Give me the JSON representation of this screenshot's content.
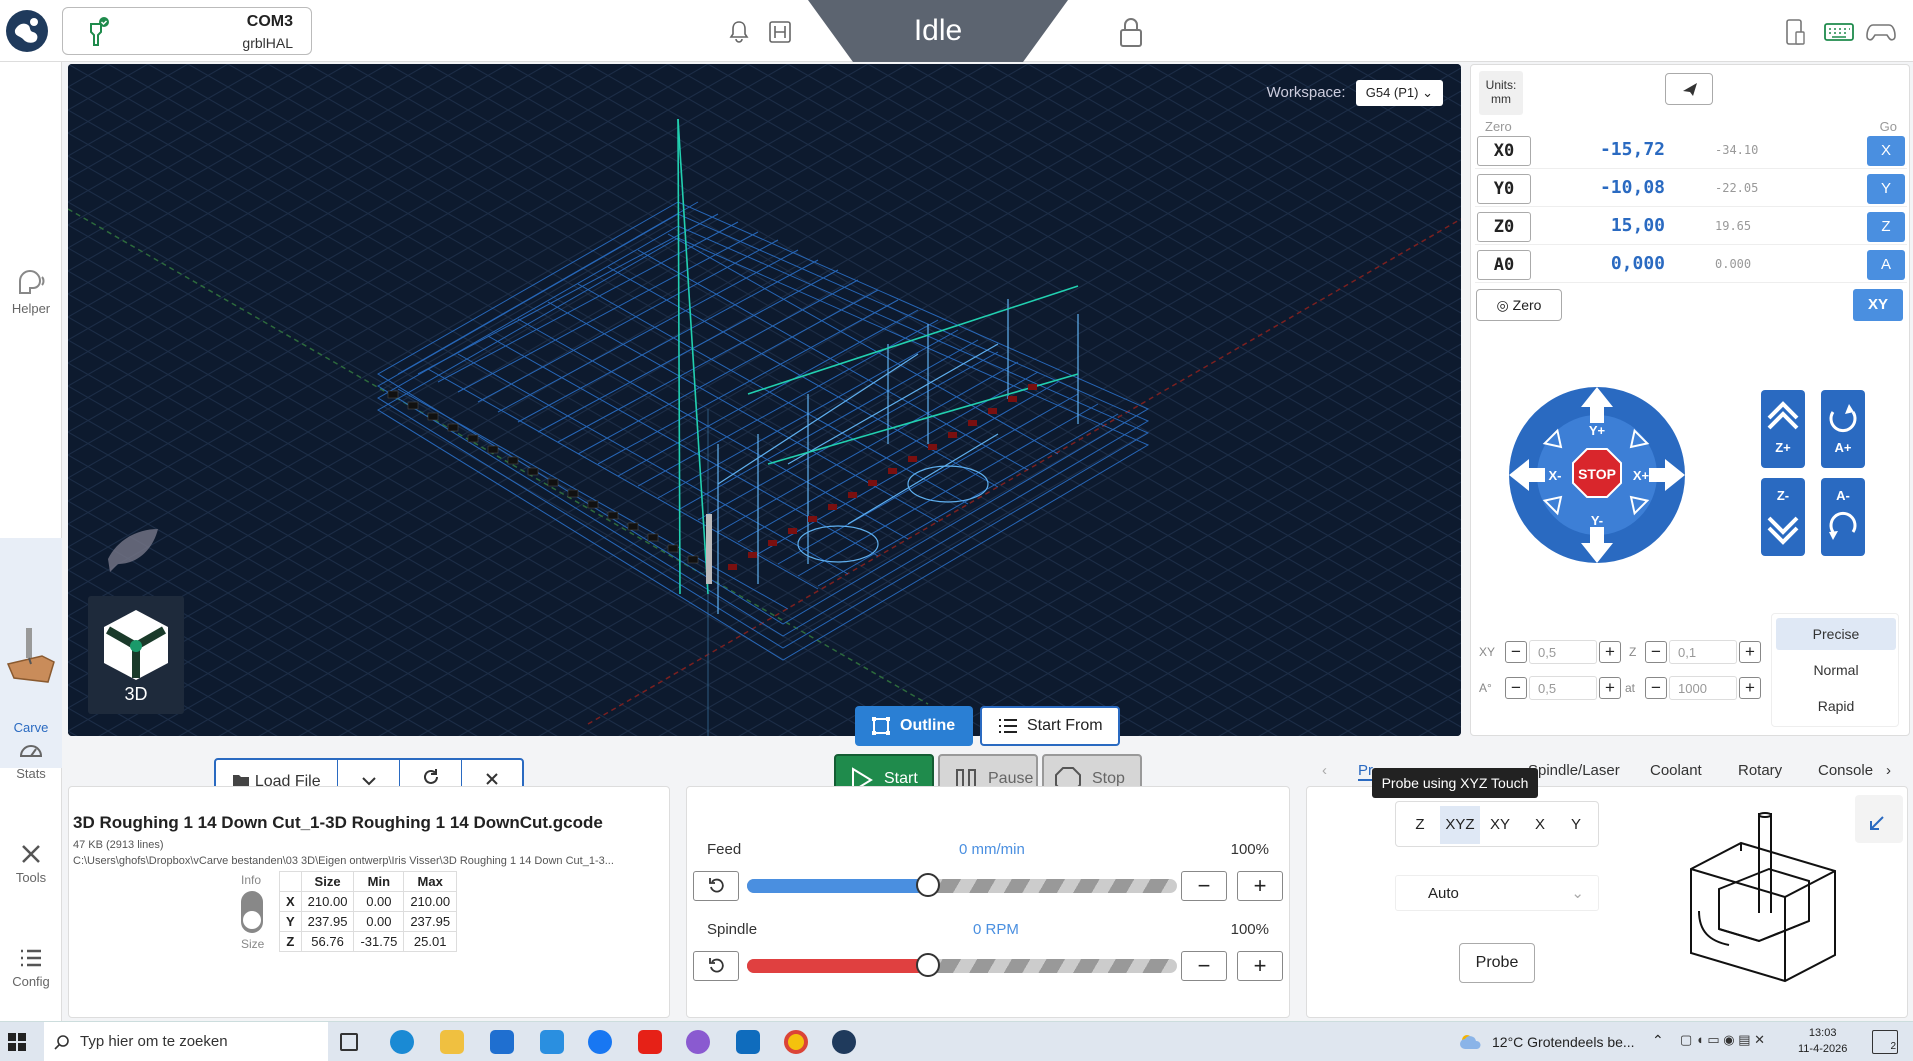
{
  "connection": {
    "port": "COM3",
    "firmware": "grblHAL"
  },
  "status": {
    "state": "Idle"
  },
  "nav": [
    {
      "label": "Helper"
    },
    {
      "label": "Carve"
    },
    {
      "label": "Stats"
    },
    {
      "label": "Tools"
    },
    {
      "label": "Config"
    }
  ],
  "viewport": {
    "workspace_label": "Workspace:",
    "workspace_value": "G54 (P1)",
    "view_label": "3D"
  },
  "dro": {
    "units_label": "Units:",
    "units_value": "mm",
    "zero_header": "Zero",
    "go_header": "Go",
    "axes": [
      {
        "name": "X0",
        "value": "-15,72",
        "mpos": "-34.10",
        "go": "X"
      },
      {
        "name": "Y0",
        "value": "-10,08",
        "mpos": "-22.05",
        "go": "Y"
      },
      {
        "name": "Z0",
        "value": "15,00",
        "mpos": "19.65",
        "go": "Z"
      },
      {
        "name": "A0",
        "value": "0,000",
        "mpos": "0.000",
        "go": "A"
      }
    ],
    "zero_button": "Zero",
    "xy_button": "XY"
  },
  "jog": {
    "y_plus": "Y+",
    "y_minus": "Y-",
    "x_plus": "X+",
    "x_minus": "X-",
    "stop": "STOP",
    "z_plus": "Z+",
    "z_minus": "Z-",
    "a_plus": "A+",
    "a_minus": "A-",
    "xy_label": "XY",
    "xy_step": "0,5",
    "z_label": "Z",
    "z_step": "0,1",
    "a_label": "A°",
    "a_step": "0,5",
    "at_label": "at",
    "a_feed": "1000",
    "modes": [
      "Precise",
      "Normal",
      "Rapid"
    ],
    "selected_mode": "Precise"
  },
  "file": {
    "load_label": "Load File",
    "name": "3D Roughing 1 14 Down Cut_1-3D Roughing 1 14 DownCut.gcode",
    "size": "47 KB (2913 lines)",
    "path": "C:\\Users\\ghofs\\Dropbox\\vCarve bestanden\\03 3D\\Eigen ontwerp\\Iris Visser\\3D Roughing 1 14 Down Cut_1-3...",
    "info_label": "Info",
    "size_label": "Size",
    "table_headers": [
      "",
      "Size",
      "Min",
      "Max"
    ],
    "table_rows": [
      [
        "X",
        "210.00",
        "0.00",
        "210.00"
      ],
      [
        "Y",
        "237.95",
        "0.00",
        "237.95"
      ],
      [
        "Z",
        "56.76",
        "-31.75",
        "25.01"
      ]
    ]
  },
  "run": {
    "outline": "Outline",
    "start_from": "Start From",
    "start": "Start",
    "pause": "Pause",
    "stop": "Stop"
  },
  "overrides": {
    "feed_label": "Feed",
    "feed_value": "0 mm/min",
    "feed_percent": "100%",
    "feed_fraction": 0.42,
    "spindle_label": "Spindle",
    "spindle_value": "0 RPM",
    "spindle_percent": "100%",
    "spindle_fraction": 0.42
  },
  "tool_tabs": [
    "Pr",
    "Spindle/Laser",
    "Coolant",
    "Rotary",
    "Console"
  ],
  "probe": {
    "tooltip": "Probe using XYZ Touch",
    "axes": [
      "Z",
      "XYZ",
      "XY",
      "X",
      "Y"
    ],
    "selected_axis": "XYZ",
    "mode": "Auto",
    "button": "Probe"
  },
  "taskbar": {
    "search_placeholder": "Typ hier om te zoeken",
    "weather": "12°C  Grotendeels be...",
    "time": "13:03",
    "date": "11-4-2026",
    "notifications": "2"
  },
  "colors": {
    "accent": "#2a7fd4",
    "stop": "#d9262c",
    "jog": "#2a6ac1",
    "feed": "#4a8fe0",
    "spindle": "#e04040",
    "start": "#1f8b4c"
  }
}
